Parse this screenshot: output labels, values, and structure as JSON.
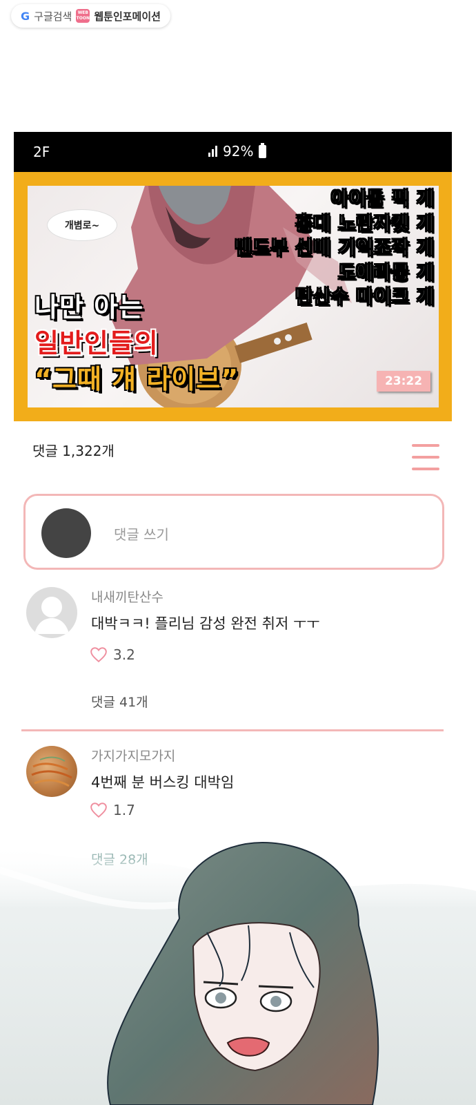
{
  "source": {
    "search_label": "구글검색",
    "site_label": "웹툰인포메이션",
    "logo_text": "WEB TOON"
  },
  "statusbar": {
    "time": "2F",
    "battery": "92%"
  },
  "video": {
    "tag": "개볌로~",
    "caption_lines": [
      "아이돌 픽 걔",
      "홍대 노란자켓 걔",
      "밴드부 선배 기억조작 걔",
      "도에라뭉 걔",
      "탄산수 마이크 걔"
    ],
    "title_line1": "나만 아는",
    "title_line2": "일반인들의",
    "title_line3": "“그때 걔 라이브”",
    "duration": "23:22"
  },
  "comments_header": {
    "count_label": "댓글 1,322개"
  },
  "write": {
    "placeholder": "댓글 쓰기"
  },
  "comments": [
    {
      "user": "내새끼탄산수",
      "text": "대박ㅋㅋ! 플리님 감성 완전 취저 ㅜㅜ",
      "likes": "3.2",
      "replies": "댓글 41개"
    },
    {
      "user": "가지가지모가지",
      "text": "4번째 분 버스킹 대박임",
      "likes": "1.7",
      "replies": "댓글 28개"
    }
  ],
  "colors": {
    "accent_pink": "#f3b7b7",
    "frame_yellow": "#f2ad1a",
    "title_red": "#e31c1c"
  }
}
